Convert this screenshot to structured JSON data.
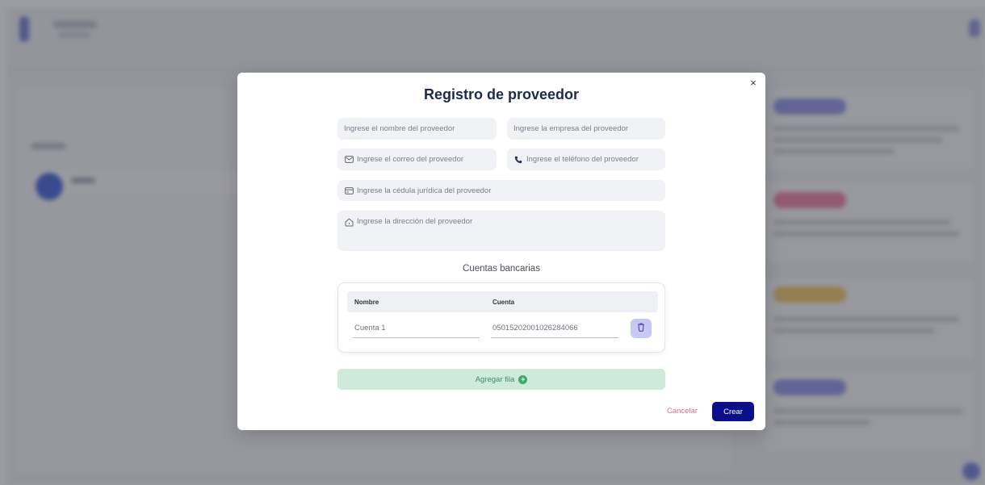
{
  "modal": {
    "title": "Registro de proveedor",
    "close_glyph": "×",
    "fields": {
      "nombre": {
        "placeholder": "Ingrese el nombre del proveedor",
        "icon": ""
      },
      "empresa": {
        "placeholder": "Ingrese la empresa del proveedor",
        "icon": ""
      },
      "correo": {
        "placeholder": "Ingrese el correo del proveedor",
        "icon": "mail-icon"
      },
      "telefono": {
        "placeholder": "Ingrese el teléfono del proveedor",
        "icon": "phone-icon"
      },
      "cedula": {
        "placeholder": "Ingrese la cédula jurídica del proveedor",
        "icon": "id-card-icon"
      },
      "direccion": {
        "placeholder": "Ingrese la dirección del proveedor",
        "icon": "home-icon"
      }
    },
    "bank_accounts": {
      "section_title": "Cuentas bancarias",
      "columns": [
        "Nombre",
        "Cuenta"
      ],
      "rows": [
        {
          "nombre": "Cuenta 1",
          "cuenta": "05015202001026284066"
        }
      ],
      "add_row_label": "Agregar fila",
      "add_row_icon": "+"
    },
    "actions": {
      "cancel_label": "Cancelar",
      "create_label": "Crear"
    }
  },
  "colors": {
    "title": "#1d2a4b",
    "primary_button": "#0b0f8a",
    "cancel_text": "#e66a8b",
    "add_row_bg": "#cdebd8",
    "add_row_text": "#3f8d5c",
    "trash_button_bg": "#c7c9f2",
    "field_bg": "#f1f2f5"
  }
}
